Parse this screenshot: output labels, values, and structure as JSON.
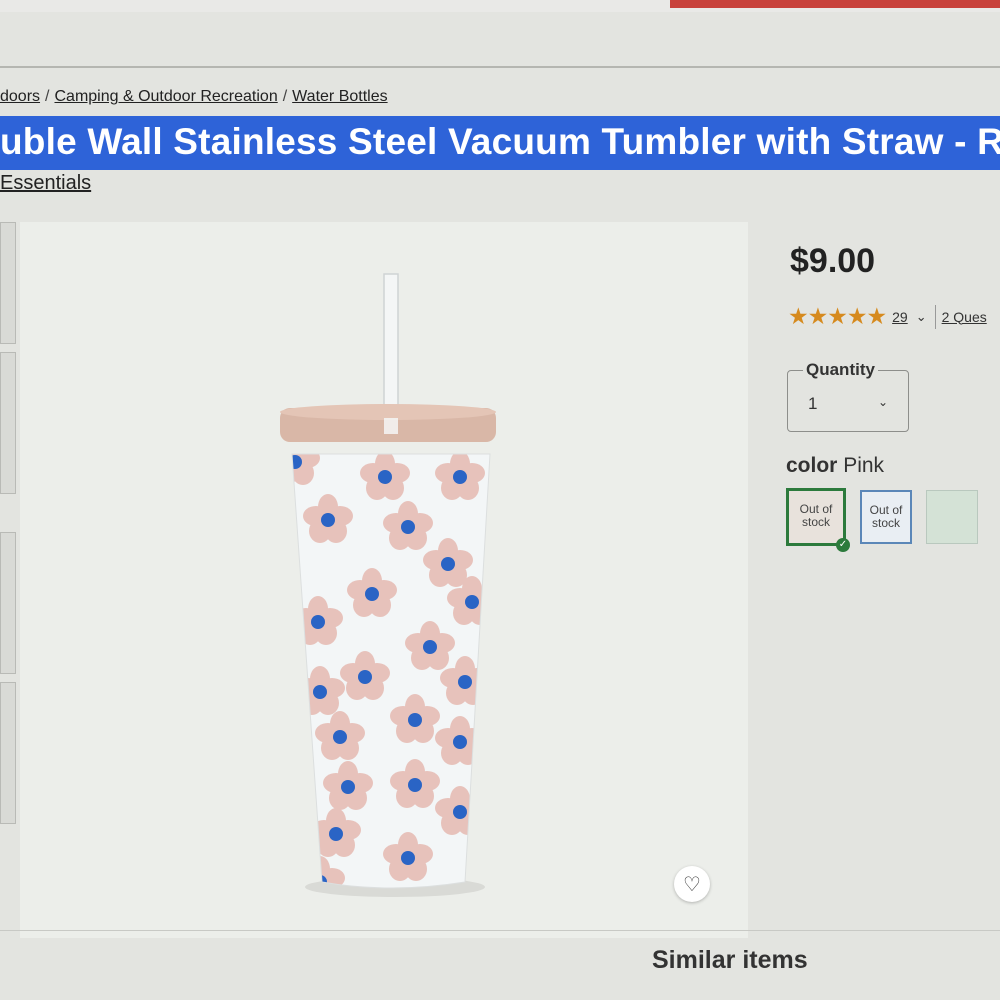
{
  "breadcrumb": {
    "items": [
      "doors",
      "Camping & Outdoor Recreation",
      "Water Bottles"
    ],
    "separator": "/"
  },
  "product": {
    "title": "uble Wall Stainless Steel Vacuum Tumbler with Straw - R",
    "brand": "Essentials",
    "price": "$9.00",
    "rating": {
      "stars": "★★★★★",
      "count": "29",
      "questions": "2 Ques"
    }
  },
  "quantity": {
    "label": "Quantity",
    "value": "1"
  },
  "color": {
    "label": "color",
    "selected": "Pink",
    "swatches": [
      {
        "status": "Out of stock",
        "selected": true
      },
      {
        "status": "Out of stock",
        "selected": false
      },
      {
        "status": "",
        "selected": false
      }
    ]
  },
  "similar": {
    "heading": "Similar items"
  },
  "colors": {
    "title_bar": "#2e63d8",
    "price_text": "#222222",
    "star": "#d68a1e",
    "selected_swatch": "#2c7a3c"
  },
  "icons": {
    "favorite": "heart-icon",
    "dropdown": "chevron-down-icon",
    "selected": "check-icon"
  }
}
